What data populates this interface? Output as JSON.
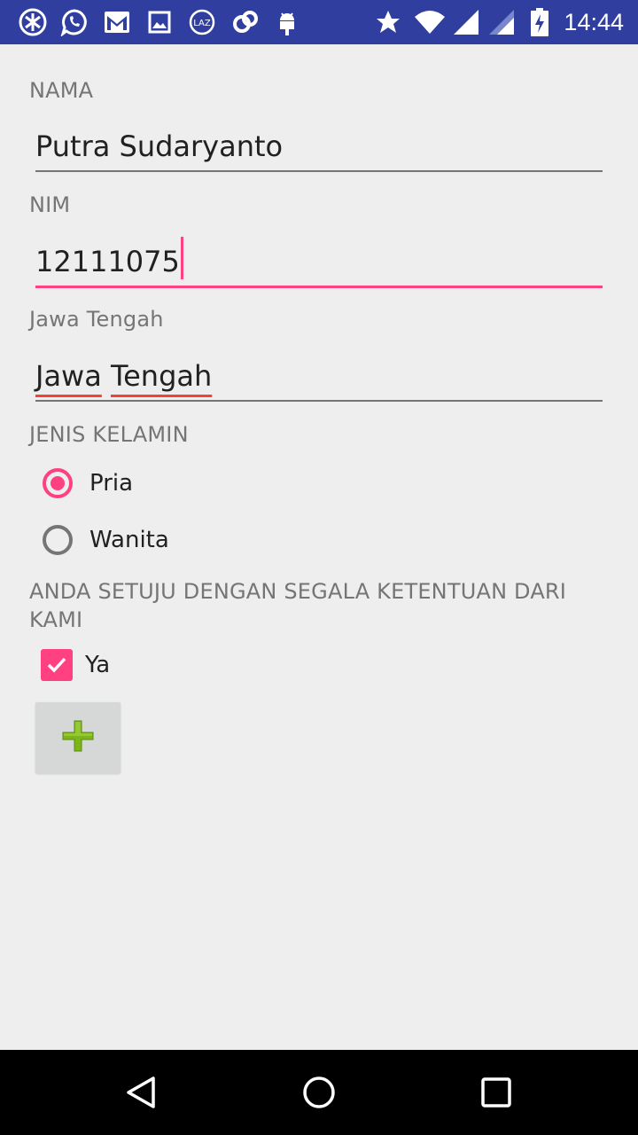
{
  "status_bar": {
    "time": "14:44",
    "left_icons": [
      "notification-app-icon",
      "whatsapp-icon",
      "gmail-icon",
      "gallery-icon",
      "lazada-icon",
      "link-app-icon",
      "android-debug-icon"
    ],
    "right_icons": [
      "star-icon",
      "wifi-icon",
      "signal-icon",
      "signal-2-icon",
      "battery-charging-icon"
    ],
    "color": "#303f9f"
  },
  "form": {
    "nama": {
      "label": "NAMA",
      "value": "Putra Sudaryanto"
    },
    "nim": {
      "label": "NIM",
      "value": "12111075"
    },
    "provinsi": {
      "label": "Jawa Tengah",
      "value_word1": "Jawa",
      "value_word2": "Tengah"
    },
    "gender": {
      "label": "JENIS KELAMIN",
      "options": [
        {
          "label": "Pria",
          "checked": true
        },
        {
          "label": "Wanita",
          "checked": false
        }
      ]
    },
    "agreement": {
      "label": "ANDA SETUJU DENGAN SEGALA KETENTUAN DARI KAMI",
      "checkbox_label": "Ya",
      "checked": true
    },
    "add_button": {
      "icon": "plus-icon"
    }
  },
  "nav_bar": {
    "icons": [
      "back-icon",
      "home-icon",
      "recents-icon"
    ]
  },
  "colors": {
    "accent": "#ff4081",
    "background": "#eeeeee",
    "hint": "#757575",
    "plus_green": "#7cb518"
  }
}
